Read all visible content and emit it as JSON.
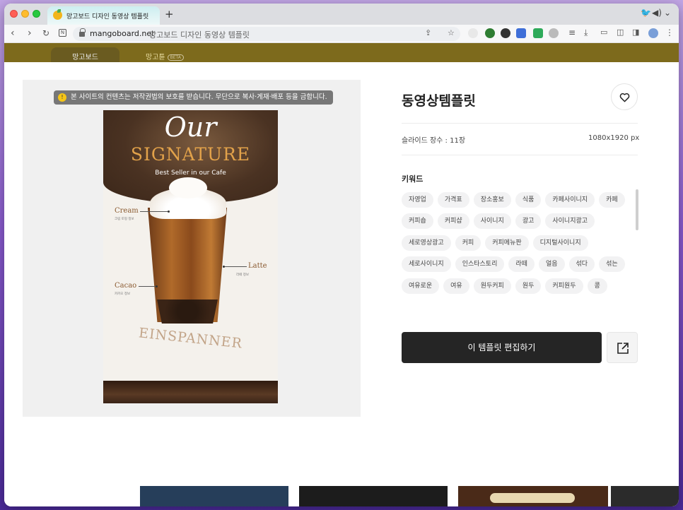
{
  "browser": {
    "tab_title": "망고보드 디자인 동영상 템플릿",
    "new_tab": "+",
    "url_host": "mangoboard.net",
    "url_path": "망고보드 디자인 동영상 템플릿",
    "nav": {
      "back": "‹",
      "forward": "›",
      "reload": "↻"
    }
  },
  "site": {
    "tab_active": "망고보드",
    "tab_other": "망고튠",
    "beta": "BETA"
  },
  "modal": {
    "notice": "본 사이트의 컨텐츠는 저작권법의 보호를 받습니다. 무단으로 복사·게재·배포 등을 금합니다.",
    "title": "동영상템플릿",
    "slide_count": "슬라이드 장수 : 11장",
    "dimensions": "1080x1920 px",
    "keywords_title": "키워드",
    "keywords": [
      "자영업",
      "가격표",
      "장소홍보",
      "식품",
      "카페사이니지",
      "카페",
      "커피숍",
      "커피샵",
      "사이니지",
      "광고",
      "사이니지광고",
      "세로영상광고",
      "커피",
      "커피메뉴판",
      "디지털사이니지",
      "세로사이니지",
      "인스타스토리",
      "라떼",
      "얼음",
      "섞다",
      "섞는",
      "여유로운",
      "여유",
      "원두커피",
      "원두",
      "커피원두",
      "콩"
    ],
    "edit_button": "이 템플릿 편집하기"
  },
  "poster": {
    "our": "Our",
    "signature": "SIGNATURE",
    "subtitle": "Best Seller in our Cafe",
    "cream": "Cream",
    "cream_desc": "크림 토핑 정보",
    "latte": "Latte",
    "latte_desc": "라떼 정보",
    "cacao": "Cacao",
    "cacao_desc": "카카오 정보",
    "name": "EINSPANNER"
  },
  "colors": {
    "site_header": "#7d6a1c",
    "edit_button_bg": "#252525",
    "chip_bg": "#f2f2f3",
    "accent_gold": "#e2a24a"
  }
}
